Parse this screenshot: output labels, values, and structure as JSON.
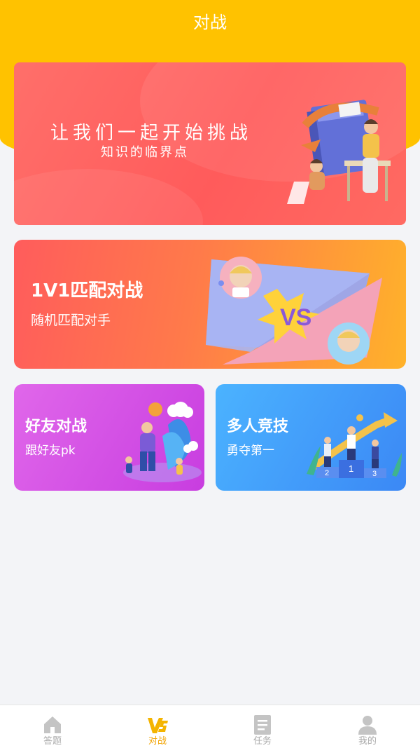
{
  "header": {
    "title": "对战"
  },
  "banner": {
    "headline": "让我们一起开始挑战",
    "subline": "知识的临界点"
  },
  "match_card": {
    "title": "1V1匹配对战",
    "subtitle": "随机匹配对手",
    "badge": "VS"
  },
  "friend_card": {
    "title": "好友对战",
    "subtitle": "跟好友pk"
  },
  "multi_card": {
    "title": "多人竞技",
    "subtitle": "勇夺第一",
    "podium": [
      "2",
      "1",
      "3"
    ]
  },
  "tabbar": {
    "items": [
      {
        "label": "答题",
        "icon": "home-icon",
        "active": false
      },
      {
        "label": "对战",
        "icon": "vs-icon",
        "active": true
      },
      {
        "label": "任务",
        "icon": "task-icon",
        "active": false
      },
      {
        "label": "我的",
        "icon": "profile-icon",
        "active": false
      }
    ]
  },
  "colors": {
    "header": "#ffc200",
    "active_tab": "#f2a300",
    "inactive_tab": "#aaaaaa"
  }
}
